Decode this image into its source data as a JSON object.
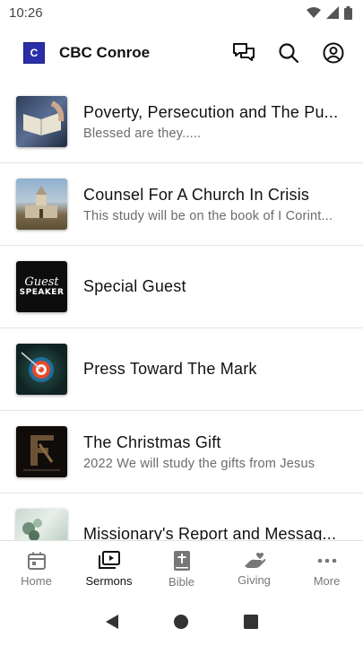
{
  "status_bar": {
    "time": "10:26"
  },
  "app_bar": {
    "logo_letter": "C",
    "title": "CBC Conroe"
  },
  "sermons": [
    {
      "title": "Poverty, Persecution and The Pu...",
      "subtitle": "Blessed are they.....",
      "thumb": "bible-hands"
    },
    {
      "title": "Counsel For A Church In Crisis",
      "subtitle": "This study will be on the book of I Corint...",
      "thumb": "church-building"
    },
    {
      "title": "Special Guest",
      "subtitle": "",
      "thumb": "guest-speaker",
      "thumb_text": [
        "Guest",
        "SPEAKER"
      ]
    },
    {
      "title": "Press Toward The Mark",
      "subtitle": "",
      "thumb": "target"
    },
    {
      "title": "The Christmas Gift",
      "subtitle": "2022 We will study the gifts from Jesus",
      "thumb": "christmas-gift"
    },
    {
      "title": "Missionary's Report and Messag...",
      "subtitle": "",
      "thumb": "flowers"
    }
  ],
  "bottom_nav": [
    {
      "label": "Home",
      "icon": "calendar-icon",
      "active": false
    },
    {
      "label": "Sermons",
      "icon": "play-stack-icon",
      "active": true
    },
    {
      "label": "Bible",
      "icon": "bible-icon",
      "active": false
    },
    {
      "label": "Giving",
      "icon": "giving-hand-icon",
      "active": false
    },
    {
      "label": "More",
      "icon": "more-dots-icon",
      "active": false
    }
  ],
  "colors": {
    "logo": "#2a2fa8",
    "active": "#111111",
    "inactive": "#777777"
  }
}
